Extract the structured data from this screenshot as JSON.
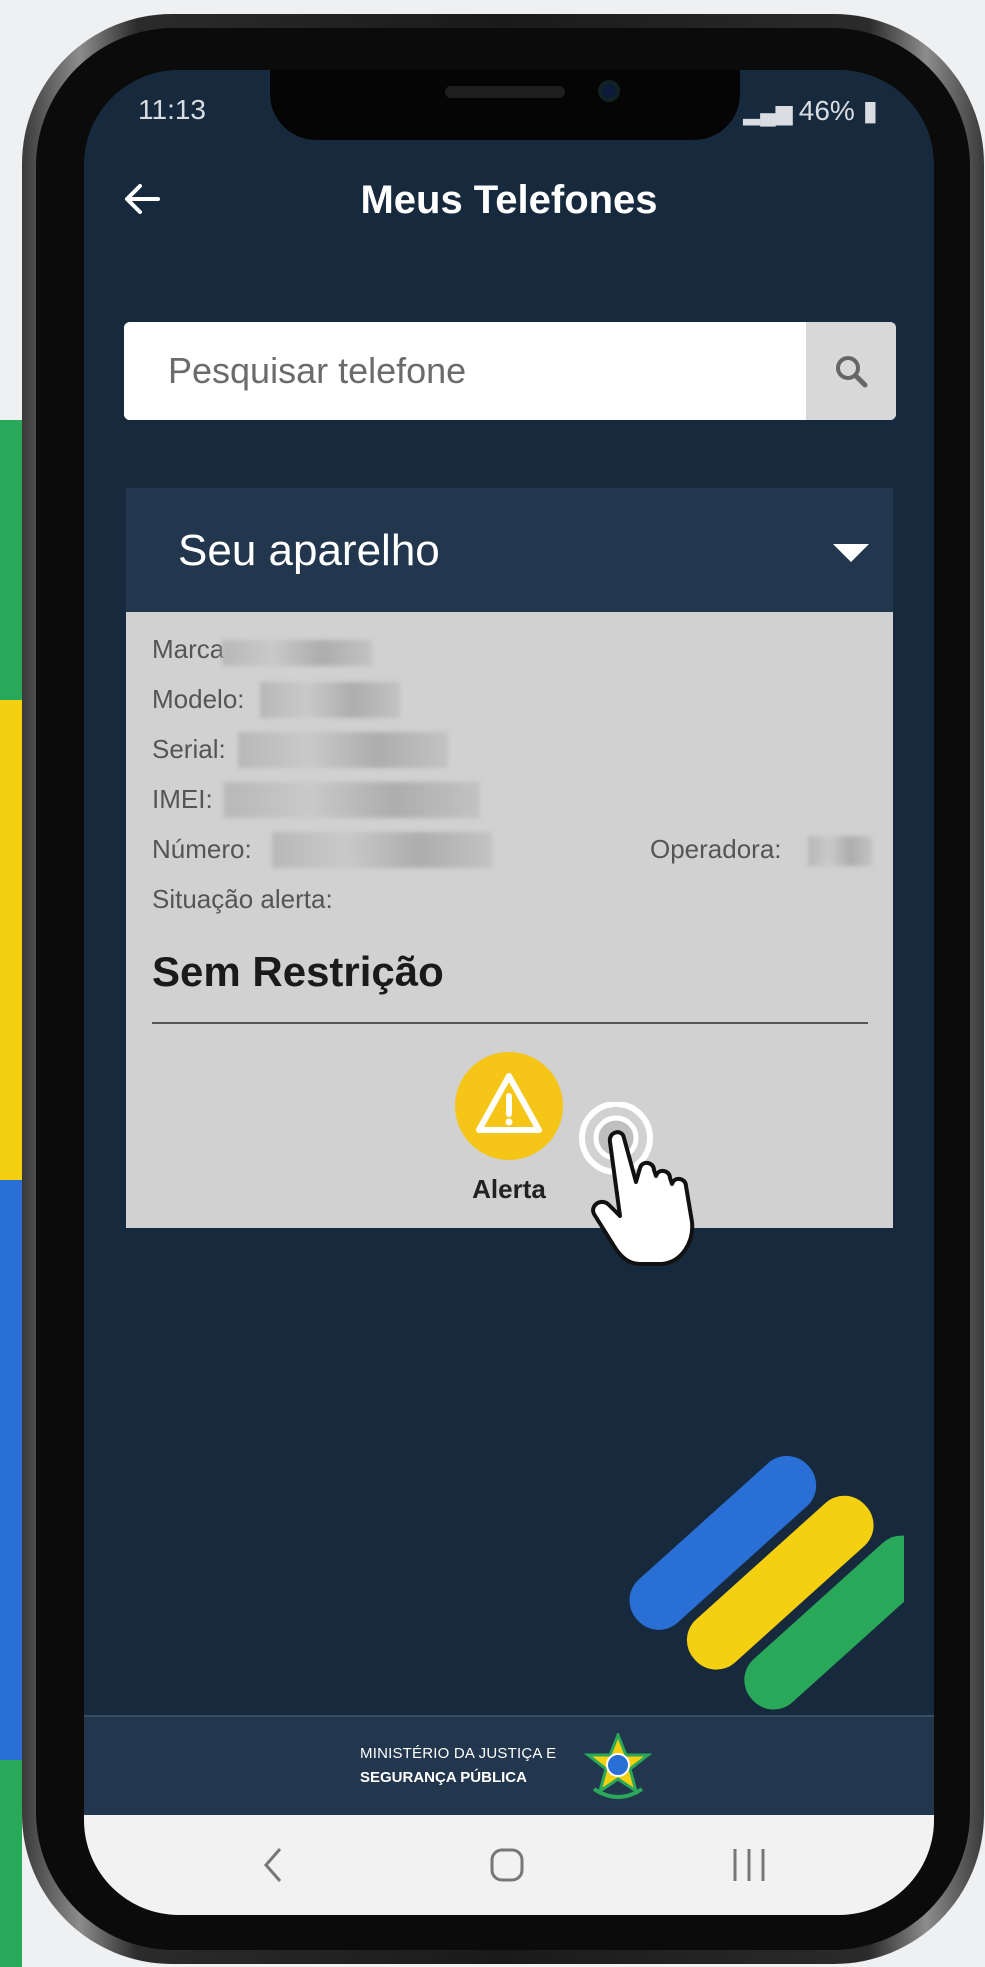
{
  "status_bar": {
    "time": "11:13",
    "battery": "46%"
  },
  "header": {
    "title": "Meus Telefones"
  },
  "search": {
    "placeholder": "Pesquisar telefone"
  },
  "device_card": {
    "title": "Seu aparelho",
    "fields": {
      "brand_label": "Marca:",
      "model_label": "Modelo:",
      "serial_label": "Serial:",
      "imei_label": "IMEI:",
      "number_label": "Número:",
      "operator_label": "Operadora:"
    },
    "situation_label": "Situação alerta:",
    "situation_value": "Sem Restrição",
    "alert_button_label": "Alerta"
  },
  "footer": {
    "ministry_line1": "MINISTÉRIO DA JUSTIÇA E",
    "ministry_line2": "SEGURANÇA PÚBLICA"
  },
  "colors": {
    "app_background": "#172a3d",
    "card_header": "#22374d",
    "card_body": "#d1d1d1",
    "alert_yellow": "#f5c518",
    "brand_blue": "#2a6fd6",
    "brand_yellow": "#f5d010",
    "brand_green": "#2aa85a"
  },
  "icons": {
    "back": "arrow-left-icon",
    "search": "magnifier-icon",
    "expand": "triangle-down-icon",
    "alert": "warning-triangle-icon",
    "tap": "hand-pointer-icon",
    "emblem": "brazil-coat-of-arms-icon",
    "nav_back": "chevron-left-icon",
    "nav_home": "rounded-square-icon",
    "nav_recents": "three-bars-icon"
  }
}
